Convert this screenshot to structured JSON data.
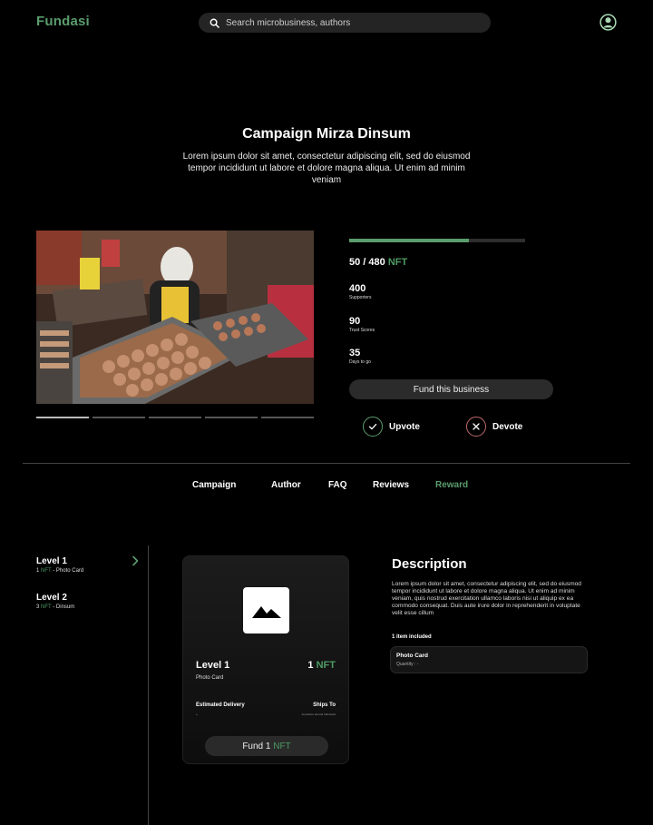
{
  "header": {
    "logo": "Fundasi",
    "search_placeholder": "Search microbusiness, authors"
  },
  "hero": {
    "title": "Campaign Mirza Dinsum",
    "description": "Lorem ipsum dolor sit amet, consectetur adipiscing elit, sed do eiusmod tempor incididunt ut labore et dolore magna aliqua. Ut enim ad minim veniam"
  },
  "gallery": {
    "slides": 5,
    "active": 0
  },
  "stats": {
    "progress": 0.68,
    "nft_count": "50 / 480",
    "nft_unit": "NFT",
    "supporters_value": "400",
    "supporters_label": "Supporters",
    "trust_value": "90",
    "trust_label": "Trust Scores",
    "days_value": "35",
    "days_label": "Days to go"
  },
  "actions": {
    "fund": "Fund this business",
    "upvote": "Upvote",
    "devote": "Devote"
  },
  "tabs": [
    {
      "label": "Campaign"
    },
    {
      "label": "Author"
    },
    {
      "label": "FAQ"
    },
    {
      "label": "Reviews"
    },
    {
      "label": "Reward"
    }
  ],
  "levels": [
    {
      "name": "Level 1",
      "count": "1",
      "unit": "NFT",
      "item": " - Photo Card"
    },
    {
      "name": "Level 2",
      "count": "3",
      "unit": "NFT",
      "item": " - Dinsum"
    }
  ],
  "reward": {
    "level": "Level 1",
    "item": "Photo Card",
    "price_count": "1",
    "price_unit": "NFT",
    "delivery_label": "Estimated Delivery",
    "delivery_value": "-",
    "ships_label": "Ships To",
    "ships_value": "Anywhere around Indonesia",
    "fund_label": "Fund 1",
    "fund_unit": "NFT"
  },
  "description": {
    "heading": "Description",
    "text": "Lorem ipsum dolor sit amet, consectetur adipiscing elit, sed do eiusmod tempor incididunt ut labore et dolore magna aliqua. Ut enim ad minim veniam, quis nostrud exercitation ullamco laboris nisi ut aliquip ex ea commodo consequat. Duis aute irure dolor in reprehenderit in voluptate velit esse cillum",
    "included_label": "1 item included",
    "item_name": "Photo Card",
    "item_qty": "Quantity : -"
  },
  "colors": {
    "accent": "#5a9d6d",
    "devote": "#c26a6a",
    "background": "#000000"
  }
}
